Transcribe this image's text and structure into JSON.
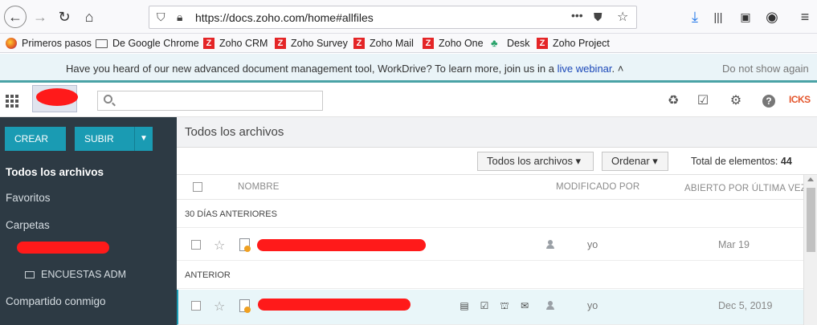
{
  "browser": {
    "url": "https://docs.zoho.com/home#allfiles",
    "bookmarks": [
      "Primeros pasos",
      "De Google Chrome",
      "Zoho CRM",
      "Zoho Survey",
      "Zoho Mail",
      "Zoho One",
      "Desk",
      "Zoho Project"
    ]
  },
  "banner": {
    "message": "Have you heard of our new advanced document management tool, WorkDrive? To learn more, join us in a",
    "link": "live webinar",
    "suffix": ". ˄",
    "dismiss": "Do not show again"
  },
  "header": {
    "search_placeholder": "",
    "brand": "ICKS"
  },
  "sidebar": {
    "create": "CREAR",
    "upload": "SUBIR",
    "items": [
      "Todos los archivos",
      "Favoritos",
      "Carpetas",
      "Compartido conmigo"
    ],
    "folder": "ENCUESTAS ADM"
  },
  "main": {
    "title": "Todos los archivos",
    "filter": "Todos los archivos ▾",
    "sort": "Ordenar ▾",
    "total_label": "Total de elementos:",
    "total_count": "44",
    "columns": {
      "name": "NOMBRE",
      "modified_by": "MODIFICADO POR",
      "opened": "ABIERTO POR ÚLTIMA VEZ ▾"
    },
    "sections": [
      "30 DÍAS ANTERIORES",
      "ANTERIOR"
    ],
    "rows": [
      {
        "owner": "yo",
        "date": "Mar 19"
      },
      {
        "owner": "yo",
        "date": "Dec 5, 2019"
      }
    ]
  }
}
